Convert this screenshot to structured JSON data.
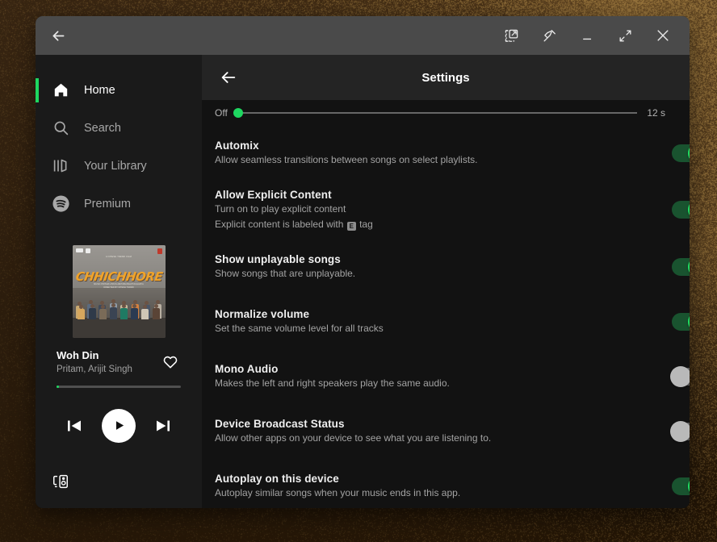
{
  "window": {
    "titlebar": {
      "back_icon": "arrow-left-icon",
      "buttons": [
        {
          "name": "picture-in-picture-icon",
          "label": "Pop out"
        },
        {
          "name": "pin-icon",
          "label": "Pin"
        },
        {
          "name": "minimize-icon",
          "label": "Minimize"
        },
        {
          "name": "maximize-icon",
          "label": "Maximize"
        },
        {
          "name": "close-icon",
          "label": "Close"
        }
      ]
    }
  },
  "sidebar": {
    "items": [
      {
        "label": "Home",
        "icon": "home-icon",
        "active": true
      },
      {
        "label": "Search",
        "icon": "search-icon",
        "active": false
      },
      {
        "label": "Your Library",
        "icon": "library-icon",
        "active": false
      },
      {
        "label": "Premium",
        "icon": "spotify-icon",
        "active": false
      }
    ],
    "now_playing": {
      "album_art_title": "CHHICHHORE",
      "album_art_credits_top": "A NITESH TIWARI FILM",
      "album_art_credits_bottom": "MUSIC  PRITAM   LYRICS  AMITABH BHATTACHARYA\nDIRECTED BY NITESH TIWARI",
      "track_title": "Woh Din",
      "track_artist": "Pritam, Arijit Singh",
      "like_icon": "heart-icon",
      "progress_percent": 1,
      "controls": [
        {
          "name": "previous-track-button",
          "icon": "skip-previous-icon"
        },
        {
          "name": "play-button",
          "icon": "play-icon"
        },
        {
          "name": "next-track-button",
          "icon": "skip-next-icon"
        }
      ]
    },
    "device_button": {
      "icon": "connect-to-device-icon",
      "label": "Connect to a device"
    }
  },
  "main": {
    "header": {
      "title": "Settings",
      "back_icon": "arrow-left-icon"
    },
    "crossfade_slider": {
      "min_label": "Off",
      "max_label": "12 s",
      "value_percent": 0
    },
    "settings": [
      {
        "name": "Automix",
        "desc": "Allow seamless transitions between songs on select playlists.",
        "toggle": "on"
      },
      {
        "name": "Allow Explicit Content",
        "desc": "Turn on to play explicit content",
        "desc2_pre": "Explicit content is labeled with ",
        "desc2_tag": "E",
        "desc2_post": " tag",
        "toggle": "on"
      },
      {
        "name": "Show unplayable songs",
        "desc": "Show songs that are unplayable.",
        "toggle": "on"
      },
      {
        "name": "Normalize volume",
        "desc": "Set the same volume level for all tracks",
        "toggle": "on"
      },
      {
        "name": "Mono Audio",
        "desc": "Makes the left and right speakers play the same audio.",
        "toggle": "off"
      },
      {
        "name": "Device Broadcast Status",
        "desc": "Allow other apps on your device to see what you are listening to.",
        "toggle": "off"
      },
      {
        "name": "Autoplay on this device",
        "desc": "Autoplay similar songs when your music ends in this app.",
        "toggle": "on"
      }
    ]
  },
  "colors": {
    "accent_green": "#1ed760",
    "toggle_on_track": "#19532f",
    "toggle_on_knob": "#1fdf64",
    "toggle_off_track": "#606060",
    "toggle_off_knob": "#b9b9b9",
    "titlebar_bg": "#4a4a4a",
    "sidebar_bg": "#1a1a1a",
    "main_bg": "#121212",
    "settings_header_bg": "#242424"
  }
}
